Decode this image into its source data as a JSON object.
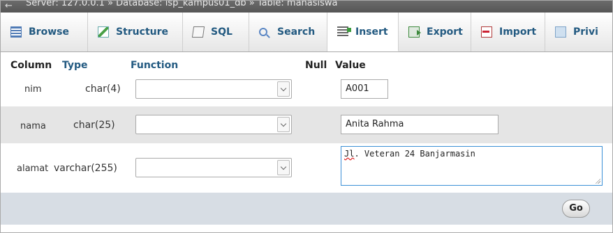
{
  "breadcrumb": {
    "text": "Server: 127.0.0.1 » Database: isp_kampus01_db » Table: mahasiswa"
  },
  "tabs": [
    {
      "label": "Browse",
      "icon": "browse-icon"
    },
    {
      "label": "Structure",
      "icon": "structure-icon"
    },
    {
      "label": "SQL",
      "icon": "sql-icon"
    },
    {
      "label": "Search",
      "icon": "search-icon"
    },
    {
      "label": "Insert",
      "icon": "insert-icon",
      "active": true
    },
    {
      "label": "Export",
      "icon": "export-icon"
    },
    {
      "label": "Import",
      "icon": "import-icon"
    },
    {
      "label": "Privi",
      "icon": "privileges-icon"
    }
  ],
  "table": {
    "headers": {
      "column": "Column",
      "type": "Type",
      "function": "Function",
      "null": "Null",
      "value": "Value"
    },
    "rows": [
      {
        "column": "nim",
        "type": "char(4)",
        "function": "",
        "value": "A001"
      },
      {
        "column": "nama",
        "type": "char(25)",
        "function": "",
        "value": "Anita Rahma"
      },
      {
        "column": "alamat",
        "type": "varchar(255)",
        "function": "",
        "value_first": "Jl",
        "value_rest": ". Veteran 24 Banjarmasin"
      }
    ]
  },
  "go_label": "Go"
}
